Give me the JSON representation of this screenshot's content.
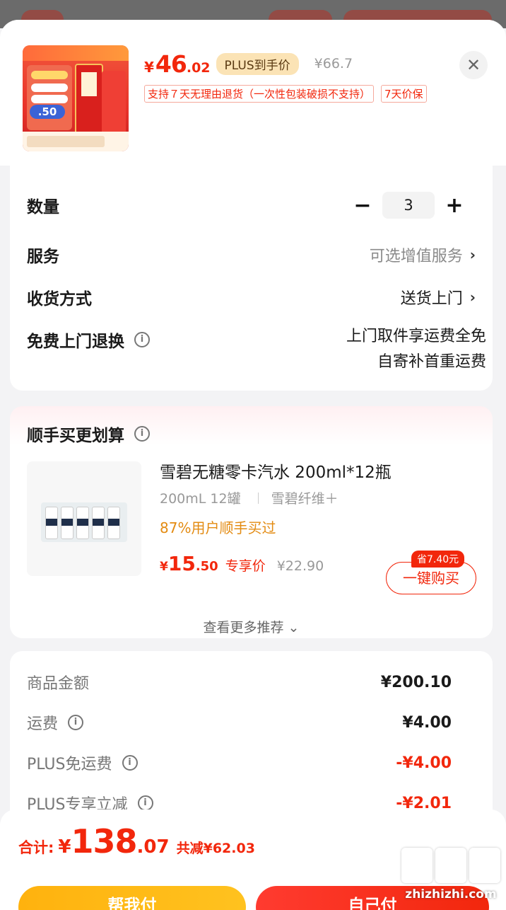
{
  "product": {
    "price_yen": "¥",
    "price_int": "46",
    "price_dec": ".02",
    "plus_tag": "PLUS到手价",
    "original_price": "¥66.7",
    "tags": [
      "支持７天无理由退货（一次性包装破损不支持）",
      "7天价保"
    ],
    "thumb_badge": ".50"
  },
  "options": {
    "quantity_label": "数量",
    "quantity_minus": "−",
    "quantity_value": "3",
    "quantity_plus": "+",
    "service_label": "服务",
    "service_value": "可选增值服务",
    "delivery_label": "收货方式",
    "delivery_value": "送货上门",
    "return_label": "免费上门退换",
    "return_line1": "上门取件享运费全免",
    "return_line2": "自寄补首重运费"
  },
  "recommend": {
    "title": "顺手买更划算",
    "item_name": "雪碧无糖零卡汽水 200ml*12瓶",
    "spec1": "200mL 12罐",
    "spec2": "雪碧纤维＋",
    "bought": "87%用户顺手买过",
    "price_yen": "¥",
    "price_int": "15",
    "price_dec": ".50",
    "price_tag": "专享价",
    "orig_price": "¥22.90",
    "save_badge": "省7.40元",
    "buy_button": "一键购买",
    "more": "查看更多推荐 ⌄"
  },
  "summary": {
    "rows": [
      {
        "label": "商品金额",
        "value": "¥200.10"
      },
      {
        "label": "运费",
        "value": "¥4.00"
      },
      {
        "label": "PLUS免运费",
        "value": "-¥4.00"
      },
      {
        "label": "PLUS专享立减",
        "value": "-¥2.01"
      }
    ]
  },
  "footer": {
    "total_label": "合计:",
    "total_yen": "¥",
    "total_int": "138",
    "total_dec": ".07",
    "total_saved": "共减¥62.03",
    "help_pay": "帮我付",
    "self_pay": "自己付"
  },
  "watermark": {
    "text": "zhizhizhi.com"
  },
  "colors": {
    "accent_red": "#f2270c",
    "plus_gold": "#fbe3b5",
    "help_button": "#ffb20e"
  }
}
